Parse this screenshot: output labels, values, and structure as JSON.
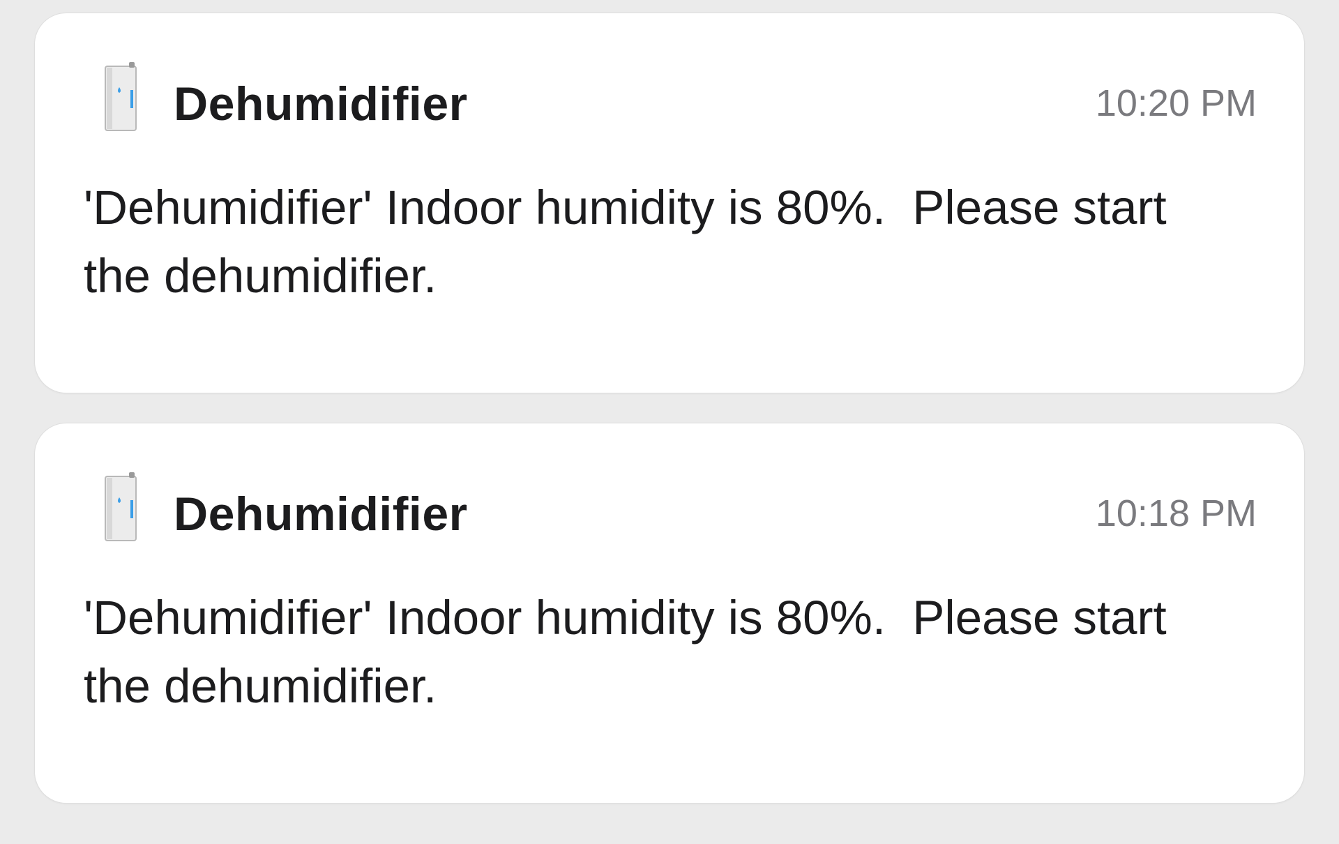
{
  "notifications": [
    {
      "app_name": "Dehumidifier",
      "icon": "dehumidifier-icon",
      "time": "10:20 PM",
      "message": "'Dehumidifier' Indoor humidity is 80%.  Please start the dehumidifier."
    },
    {
      "app_name": "Dehumidifier",
      "icon": "dehumidifier-icon",
      "time": "10:18 PM",
      "message": "'Dehumidifier' Indoor humidity is 80%.  Please start the dehumidifier."
    }
  ],
  "colors": {
    "background": "#ebebeb",
    "card": "#ffffff",
    "text": "#1c1c1e",
    "time": "#7a7a7e",
    "water_drop": "#3a9ee8"
  }
}
